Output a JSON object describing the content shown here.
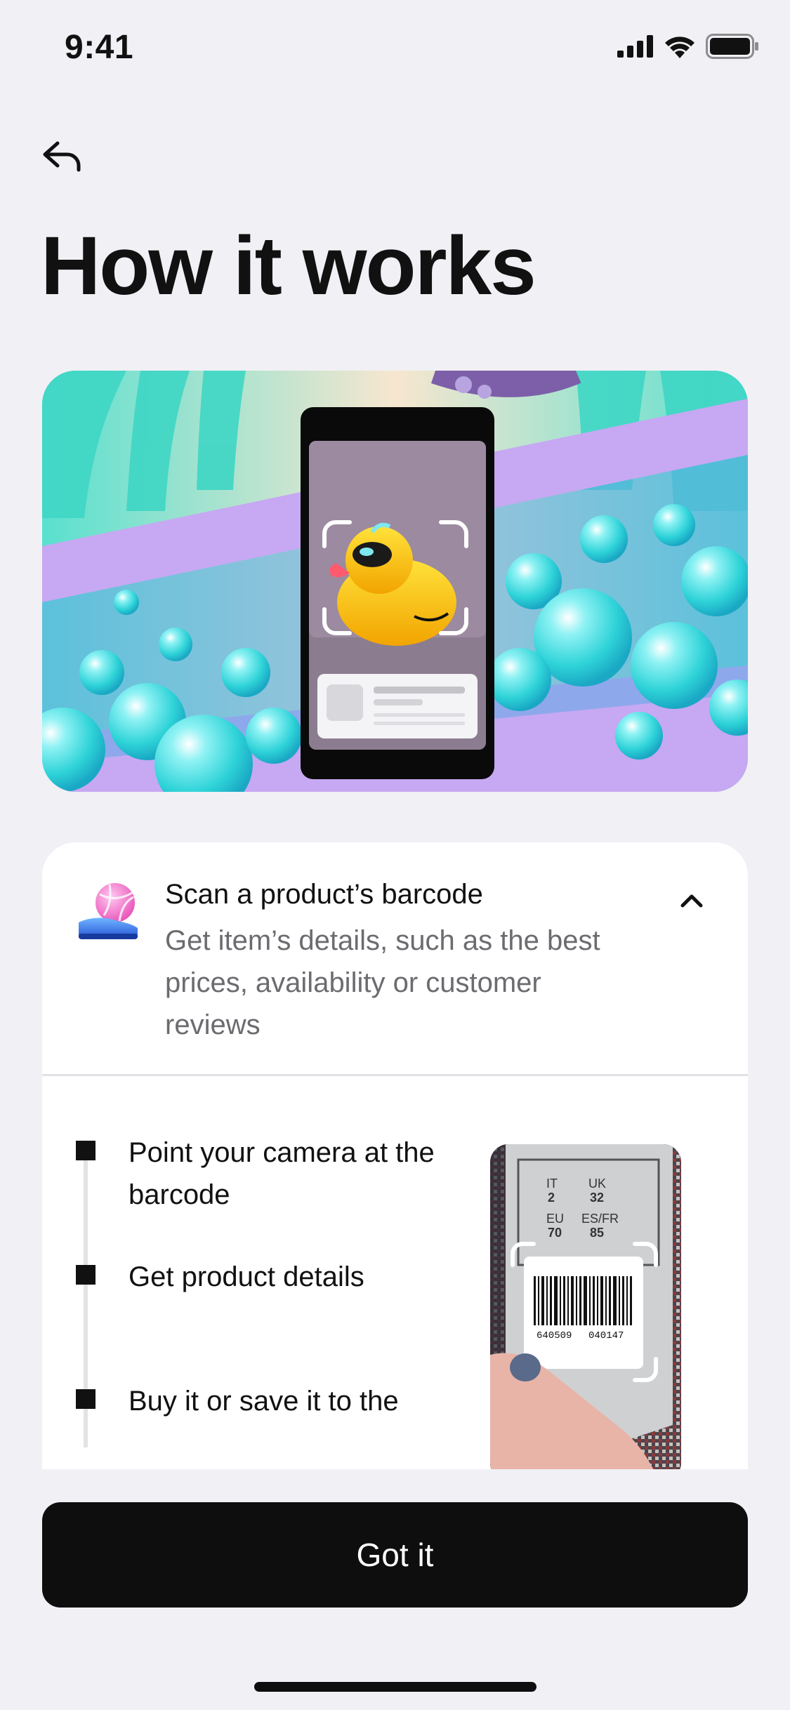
{
  "status_bar": {
    "time": "9:41",
    "icons": [
      "cellular-signal-icon",
      "wifi-icon",
      "battery-icon"
    ]
  },
  "header": {
    "back_icon": "back-arrow-icon",
    "title": "How it works"
  },
  "hero": {
    "description_icon": "phone-scanning-duck-illustration"
  },
  "feature_card": {
    "icon": "sneaker-ball-icon",
    "title": "Scan a product’s barcode",
    "description": "Get item’s details, such as the best prices, availability or customer reviews",
    "toggle_icon": "chevron-up-icon",
    "steps": [
      {
        "label": "Point your camera at the barcode"
      },
      {
        "label": "Get product details"
      },
      {
        "label": "Buy it or save it to the"
      }
    ],
    "scan_photo": {
      "size_labels": {
        "it": "IT",
        "it_val": "2",
        "uk": "UK",
        "uk_val": "32",
        "eu": "EU",
        "eu_val": "70",
        "esfr": "ES/FR",
        "esfr_val": "85"
      },
      "barcode_number_left": "640509",
      "barcode_number_right": "040147"
    }
  },
  "actions": {
    "primary_label": "Got it"
  },
  "colors": {
    "background": "#f1f0f5",
    "button": "#0e0e0e",
    "card": "#ffffff",
    "secondary_text": "#6b6b70"
  }
}
